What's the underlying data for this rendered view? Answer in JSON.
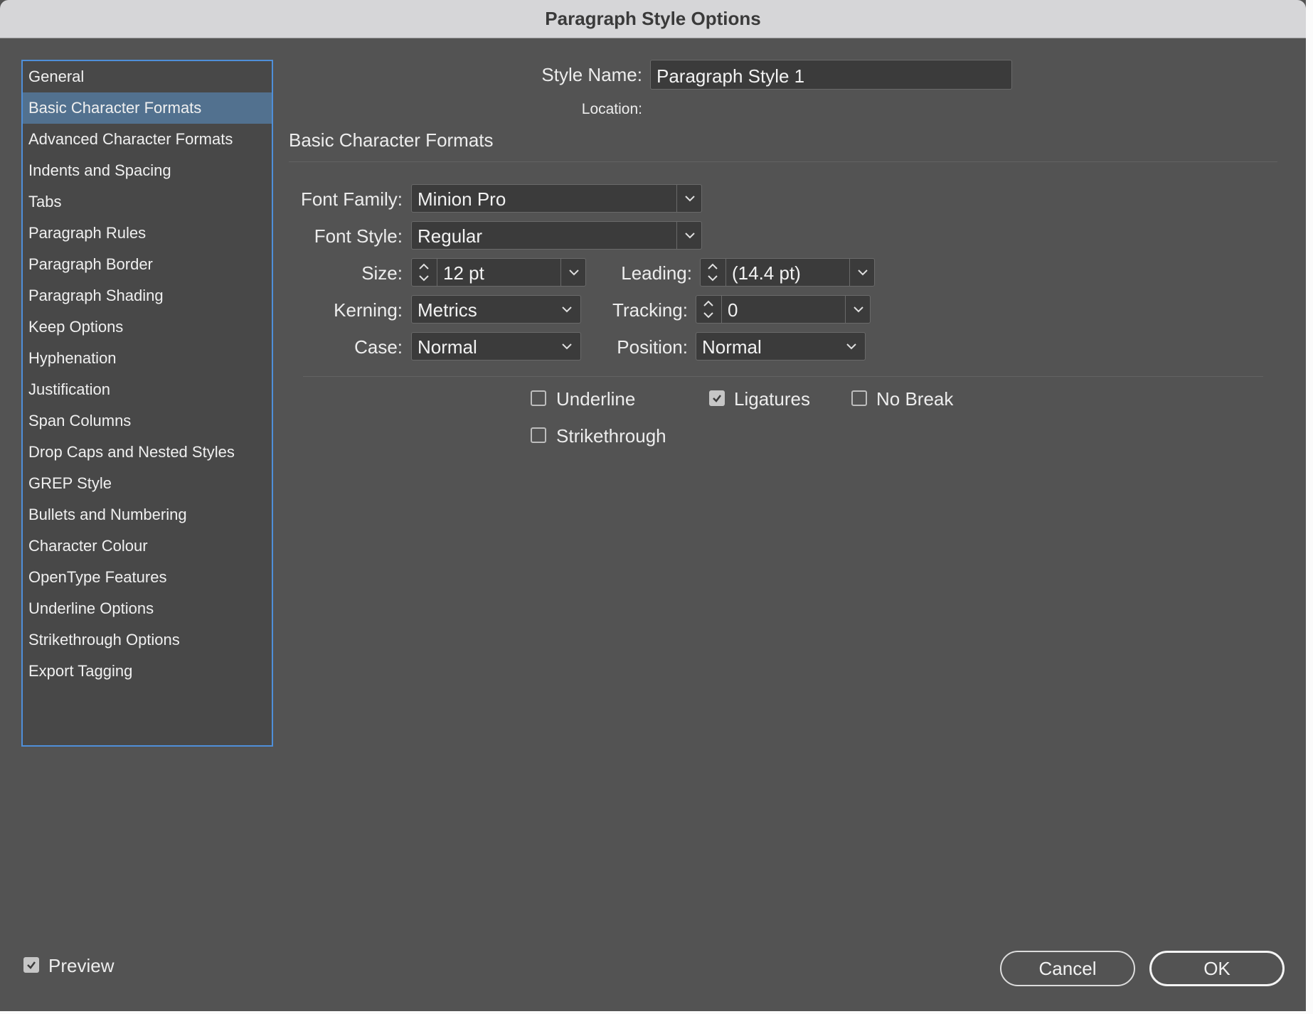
{
  "window": {
    "title": "Paragraph Style Options"
  },
  "sidebar": {
    "items": [
      {
        "label": "General"
      },
      {
        "label": "Basic Character Formats",
        "active": true
      },
      {
        "label": "Advanced Character Formats"
      },
      {
        "label": "Indents and Spacing"
      },
      {
        "label": "Tabs"
      },
      {
        "label": "Paragraph Rules"
      },
      {
        "label": "Paragraph Border"
      },
      {
        "label": "Paragraph Shading"
      },
      {
        "label": "Keep Options"
      },
      {
        "label": "Hyphenation"
      },
      {
        "label": "Justification"
      },
      {
        "label": "Span Columns"
      },
      {
        "label": "Drop Caps and Nested Styles"
      },
      {
        "label": "GREP Style"
      },
      {
        "label": "Bullets and Numbering"
      },
      {
        "label": "Character Colour"
      },
      {
        "label": "OpenType Features"
      },
      {
        "label": "Underline Options"
      },
      {
        "label": "Strikethrough Options"
      },
      {
        "label": "Export Tagging"
      }
    ]
  },
  "header": {
    "style_name_label": "Style Name:",
    "style_name_value": "Paragraph Style 1",
    "location_label": "Location:",
    "section_title": "Basic Character Formats"
  },
  "form": {
    "font_family": {
      "label": "Font Family:",
      "value": "Minion Pro"
    },
    "font_style": {
      "label": "Font Style:",
      "value": "Regular"
    },
    "size": {
      "label": "Size:",
      "value": "12 pt"
    },
    "leading": {
      "label": "Leading:",
      "value": "(14.4 pt)"
    },
    "kerning": {
      "label": "Kerning:",
      "value": "Metrics"
    },
    "tracking": {
      "label": "Tracking:",
      "value": "0"
    },
    "case": {
      "label": "Case:",
      "value": "Normal"
    },
    "position": {
      "label": "Position:",
      "value": "Normal"
    }
  },
  "checkboxes": {
    "underline": {
      "label": "Underline",
      "checked": false
    },
    "ligatures": {
      "label": "Ligatures",
      "checked": true
    },
    "no_break": {
      "label": "No Break",
      "checked": false
    },
    "strikethrough": {
      "label": "Strikethrough",
      "checked": false
    }
  },
  "footer": {
    "preview": {
      "label": "Preview",
      "checked": true
    },
    "cancel_label": "Cancel",
    "ok_label": "OK"
  },
  "colors": {
    "background": "#535353",
    "selected_item": "#52718f",
    "focus_border": "#4f8fd9"
  }
}
